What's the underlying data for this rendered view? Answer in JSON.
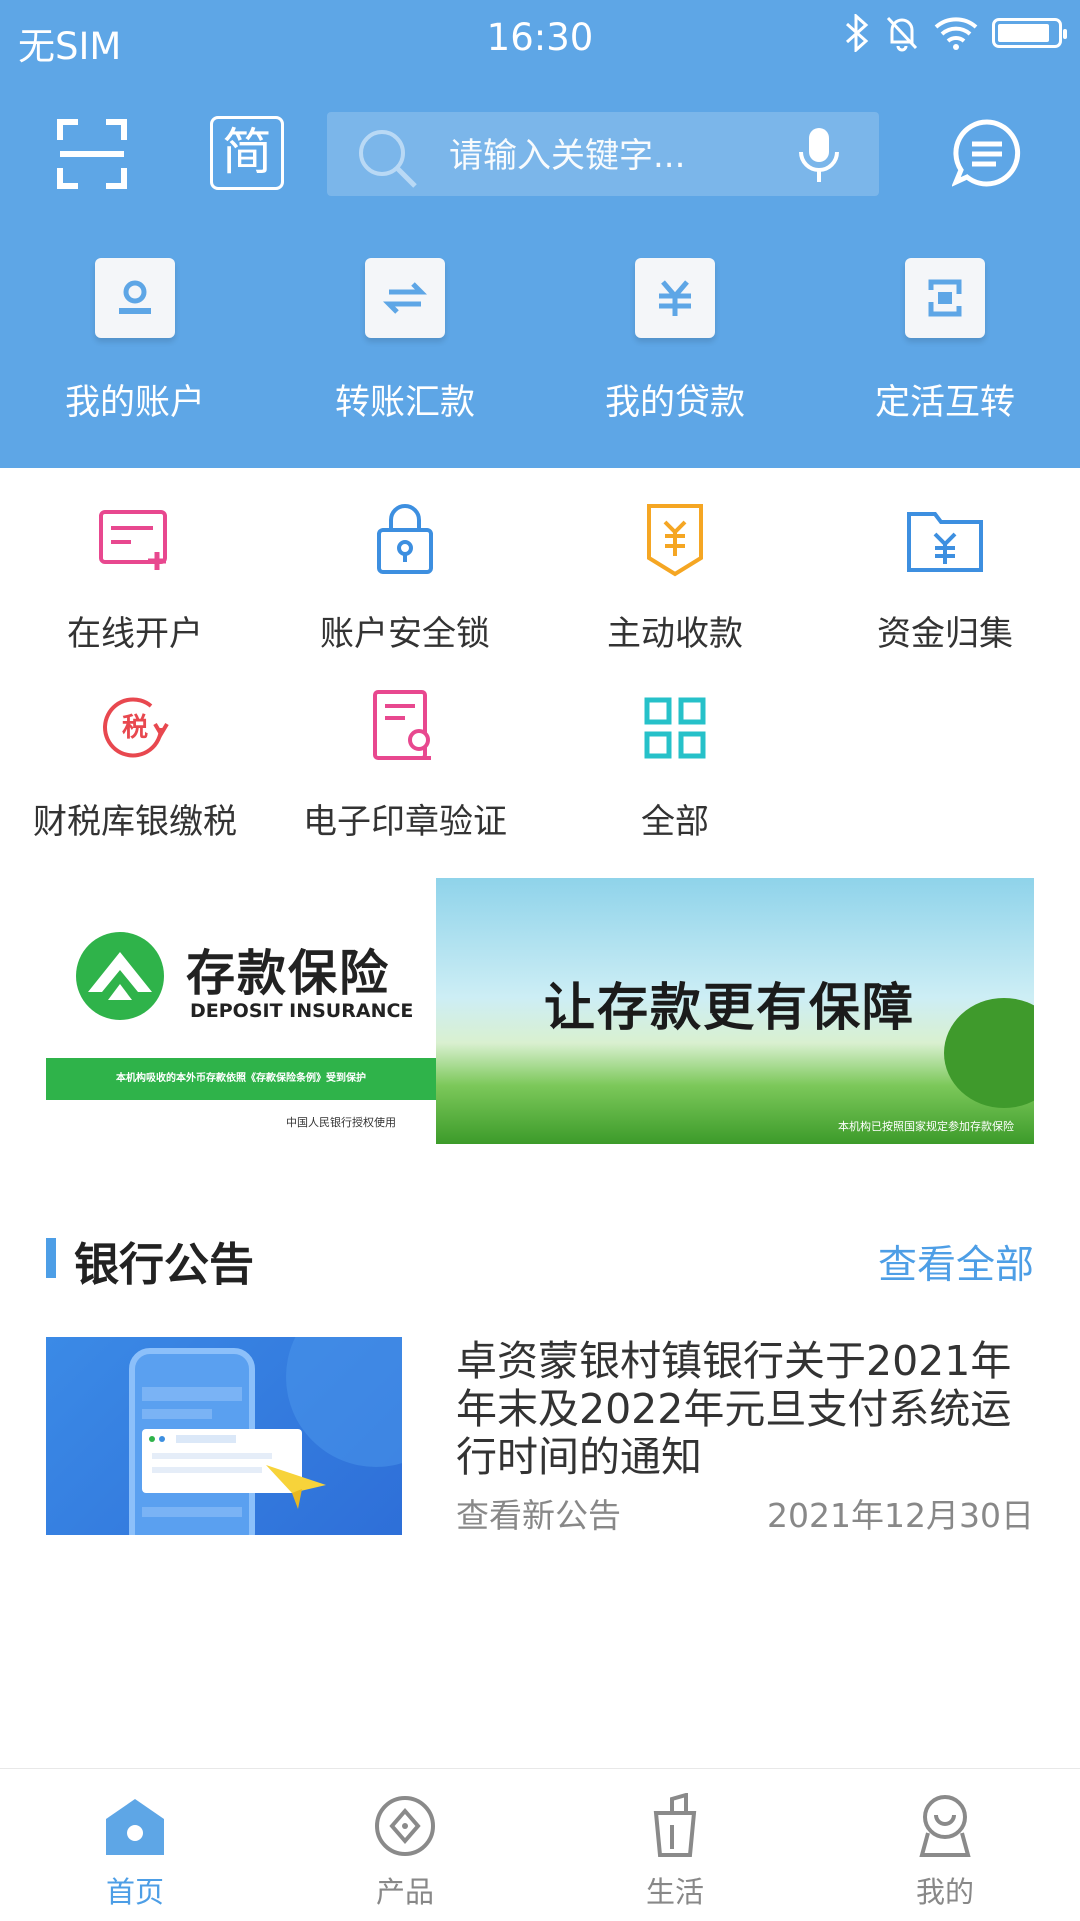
{
  "status_bar": {
    "carrier": "无SIM",
    "time": "16:30"
  },
  "toolbar": {
    "simplified_label": "简",
    "search_placeholder": "请输入关键字..."
  },
  "quick_actions": [
    {
      "label": "我的账户",
      "icon": "account-icon"
    },
    {
      "label": "转账汇款",
      "icon": "transfer-icon"
    },
    {
      "label": "我的贷款",
      "icon": "loan-icon"
    },
    {
      "label": "定活互转",
      "icon": "deposit-convert-icon"
    }
  ],
  "services": [
    {
      "label": "在线开户",
      "icon": "online-account-icon"
    },
    {
      "label": "账户安全锁",
      "icon": "security-lock-icon"
    },
    {
      "label": "主动收款",
      "icon": "collection-icon"
    },
    {
      "label": "资金归集",
      "icon": "fund-pool-icon"
    },
    {
      "label": "财税库银缴税",
      "icon": "tax-icon"
    },
    {
      "label": "电子印章验证",
      "icon": "seal-verify-icon"
    },
    {
      "label": "全部",
      "icon": "grid-all-icon"
    }
  ],
  "banner": {
    "title_cn": "存款保险",
    "title_en": "DEPOSIT INSURANCE",
    "strip_text": "本机构吸收的本外币存款依照《存款保险条例》受到保护",
    "authorized": "中国人民银行授权使用",
    "slogan": "让存款更有保障",
    "note": "本机构已按照国家规定参加存款保险"
  },
  "notices": {
    "section_title": "银行公告",
    "view_all": "查看全部",
    "items": [
      {
        "title": "卓资蒙银村镇银行关于2021年年末及2022年元旦支付系统运行时间的通知",
        "subtitle": "查看新公告",
        "date": "2021年12月30日"
      }
    ]
  },
  "tabs": [
    {
      "label": "首页",
      "active": true
    },
    {
      "label": "产品",
      "active": false
    },
    {
      "label": "生活",
      "active": false
    },
    {
      "label": "我的",
      "active": false
    }
  ],
  "colors": {
    "header_blue": "#5ea6e6",
    "accent": "#4d9ee6",
    "pink": "#e8488f",
    "teal": "#26c1c9",
    "orange": "#f5a623"
  }
}
